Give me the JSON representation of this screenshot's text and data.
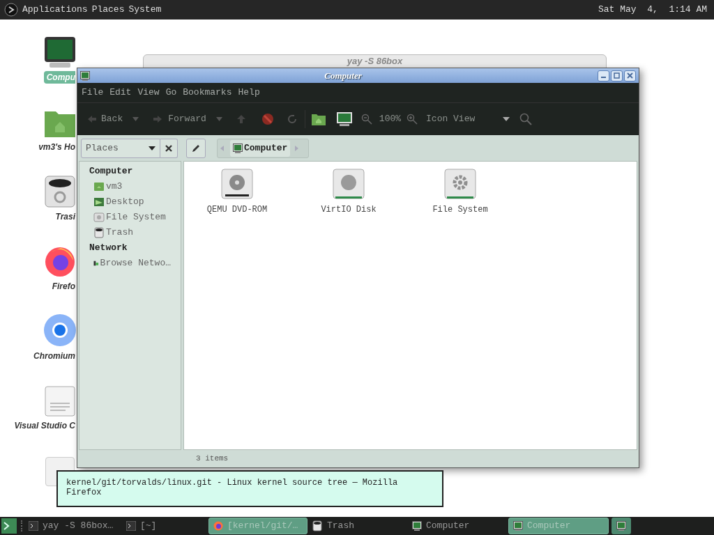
{
  "top_panel": {
    "menus": [
      "Applications",
      "Places",
      "System"
    ],
    "clock": "Sat May  4,  1:14 AM"
  },
  "desktop_icons": [
    {
      "label": "Compu",
      "kind": "computer",
      "selected": true
    },
    {
      "label": "vm3's Ho",
      "kind": "home",
      "selected": false
    },
    {
      "label": "Trasi",
      "kind": "trash",
      "selected": false
    },
    {
      "label": "Firefo",
      "kind": "firefox",
      "selected": false
    },
    {
      "label": "Chromium",
      "kind": "chromium",
      "selected": false
    },
    {
      "label": "Visual Studio C",
      "kind": "document",
      "selected": false
    },
    {
      "kind": "blank",
      "selected": false
    }
  ],
  "background_window": {
    "title": "yay -S 86box"
  },
  "window": {
    "title": "Computer",
    "menu": [
      "File",
      "Edit",
      "View",
      "Go",
      "Bookmarks",
      "Help"
    ],
    "toolbar": {
      "back": "Back",
      "forward": "Forward",
      "zoom": "100%",
      "view": "Icon View"
    },
    "location": {
      "places": "Places",
      "crumb": "Computer"
    },
    "sidebar": [
      {
        "heading": "Computer",
        "items": [
          {
            "label": "vm3",
            "kind": "home"
          },
          {
            "label": "Desktop",
            "kind": "desktop"
          },
          {
            "label": "File System",
            "kind": "drive"
          },
          {
            "label": "Trash",
            "kind": "trash"
          }
        ]
      },
      {
        "heading": "Network",
        "items": [
          {
            "label": "Browse Netwo…",
            "kind": "network"
          }
        ]
      }
    ],
    "items": [
      {
        "label": "QEMU DVD-ROM",
        "kind": "optical"
      },
      {
        "label": "VirtIO Disk",
        "kind": "disk"
      },
      {
        "label": "File System",
        "kind": "system"
      }
    ],
    "status": "3 items"
  },
  "tooltip": "kernel/git/torvalds/linux.git - Linux kernel source tree — Mozilla Firefox",
  "taskbar": [
    {
      "label": "yay -S 86box…",
      "kind": "terminal",
      "selected": false
    },
    {
      "label": "[~]",
      "kind": "terminal",
      "selected": false
    },
    {
      "label": "[kernel/git/…",
      "kind": "firefox",
      "selected": true
    },
    {
      "label": "Trash",
      "kind": "trash",
      "selected": false
    },
    {
      "label": "Computer",
      "kind": "computer",
      "selected": false
    },
    {
      "label": "Computer",
      "kind": "computer",
      "selected": true
    }
  ]
}
